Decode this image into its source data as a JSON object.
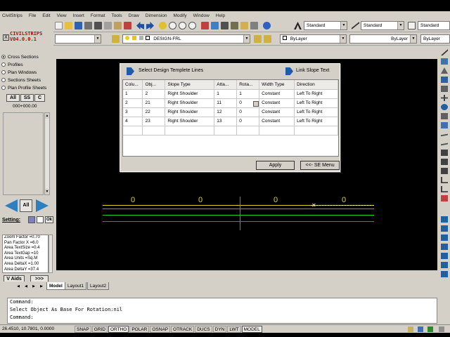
{
  "app": {
    "title": "CivilStrips",
    "menus": [
      "CivilStrips",
      "File",
      "Edit",
      "View",
      "Insert",
      "Format",
      "Tools",
      "Draw",
      "Dimension",
      "Modify",
      "Window",
      "Help"
    ]
  },
  "toolbar": {
    "textstyle": "Standard",
    "dimstyle": "Standard",
    "tablestyle": "Standard",
    "layer": "DESIGN-FRL",
    "color": "ByLayer",
    "linetype": "ByLayer",
    "lineweight": "ByLayer"
  },
  "panel": {
    "logo_line1": "CIVILSTRIPS",
    "logo_line2": "V04.0.0.1",
    "close_label": "X",
    "options": [
      {
        "label": "Cross Sections",
        "selected": true
      },
      {
        "label": "Profiles",
        "selected": false
      },
      {
        "label": "Plan Windows",
        "selected": false
      },
      {
        "label": "Sections Sheets",
        "selected": false
      },
      {
        "label": "Plan Profile Sheets",
        "selected": false
      }
    ],
    "btn_all": "All",
    "btn_ss": "SS",
    "btn_c": "C",
    "chainage": "000+000.00",
    "nav_all": "All",
    "setting_label": "Setting:",
    "ok_label": "Ok",
    "info_lines": [
      "Zoom Factor =0.70",
      "Pan Factor X =6.0",
      "Area TextSize =0.4",
      "Area TextGap =10",
      "Area Units =Sq.M",
      "Area DeltaX =1.00",
      "Area DeltaY =37.4"
    ],
    "vaids_label": "V Aids",
    "more_label": ">>>"
  },
  "dialog": {
    "select_lines_label": "Select Design Templete Lines",
    "link_slope_label": "Link Slope Text",
    "columns": [
      "Colu...",
      "Obj...",
      "Slope Type",
      "Atta...",
      "Rota...",
      "Width Type",
      "Direction"
    ],
    "rows": [
      [
        "1",
        "2",
        "Right Shoulder",
        "1",
        "1",
        "Constant",
        "Left To Right"
      ],
      [
        "2",
        "21",
        "Right Shoulder",
        "11",
        "0",
        "Constant",
        "Left To Right"
      ],
      [
        "3",
        "22",
        "Right Shoulder",
        "12",
        "0",
        "Constant",
        "Left To Right"
      ],
      [
        "4",
        "23",
        "Right Shoulder",
        "13",
        "0",
        "Constant",
        "Left To Right"
      ]
    ],
    "apply_label": "Apply",
    "se_menu_label": "<<- SE Menu"
  },
  "canvas": {
    "slope_labels": [
      "0",
      "0",
      "0",
      "0"
    ]
  },
  "tabs": [
    "Model",
    "Layout1",
    "Layout2"
  ],
  "command": {
    "line1": "Command:",
    "line2": " Select Object As Base For Rotation:nil",
    "line3": "Command:"
  },
  "status": {
    "coords": "26.4510, 10.7801, 0.0000",
    "toggles": [
      "SNAP",
      "GRID",
      "ORTHO",
      "POLAR",
      "OSNAP",
      "OTRACK",
      "DUCS",
      "DYN",
      "LWT",
      "MODEL"
    ]
  },
  "colors": {
    "canvas": "#000000",
    "line_yellow": "#d8d820",
    "line_green": "#20d020",
    "line_red": "#ff3030",
    "line_magenta": "#d040d0",
    "logo_red": "#cc0000",
    "accent_blue": "#1e5ca8"
  }
}
